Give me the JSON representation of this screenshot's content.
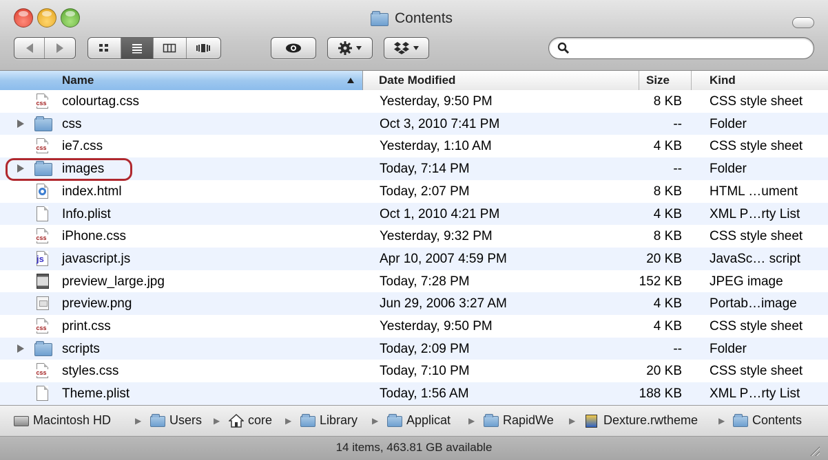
{
  "window": {
    "title": "Contents",
    "view_modes": [
      "icon-view",
      "list-view",
      "column-view",
      "coverflow-view"
    ],
    "active_view": "list-view"
  },
  "toolbar": {
    "search_placeholder": ""
  },
  "columns": {
    "name": "Name",
    "date": "Date Modified",
    "size": "Size",
    "kind": "Kind"
  },
  "rows": [
    {
      "name": "colourtag.css",
      "date": "Yesterday, 9:50 PM",
      "size": "8 KB",
      "kind": "CSS style sheet",
      "icon": "css-file-icon"
    },
    {
      "name": "css",
      "date": "Oct 3, 2010 7:41 PM",
      "size": "--",
      "kind": "Folder",
      "icon": "folder-icon"
    },
    {
      "name": "ie7.css",
      "date": "Yesterday, 1:10 AM",
      "size": "4 KB",
      "kind": "CSS style sheet",
      "icon": "css-file-icon"
    },
    {
      "name": "images",
      "date": "Today, 7:14 PM",
      "size": "--",
      "kind": "Folder",
      "icon": "folder-icon"
    },
    {
      "name": "index.html",
      "date": "Today, 2:07 PM",
      "size": "8 KB",
      "kind": "HTML …ument",
      "icon": "html-file-icon"
    },
    {
      "name": "Info.plist",
      "date": "Oct 1, 2010 4:21 PM",
      "size": "4 KB",
      "kind": "XML P…rty List",
      "icon": "plist-file-icon"
    },
    {
      "name": "iPhone.css",
      "date": "Yesterday, 9:32 PM",
      "size": "8 KB",
      "kind": "CSS style sheet",
      "icon": "css-file-icon"
    },
    {
      "name": "javascript.js",
      "date": "Apr 10, 2007 4:59 PM",
      "size": "20 KB",
      "kind": "JavaSc… script",
      "icon": "js-file-icon"
    },
    {
      "name": "preview_large.jpg",
      "date": "Today, 7:28 PM",
      "size": "152 KB",
      "kind": "JPEG image",
      "icon": "jpeg-file-icon"
    },
    {
      "name": "preview.png",
      "date": "Jun 29, 2006 3:27 AM",
      "size": "4 KB",
      "kind": "Portab…image",
      "icon": "png-file-icon"
    },
    {
      "name": "print.css",
      "date": "Yesterday, 9:50 PM",
      "size": "4 KB",
      "kind": "CSS style sheet",
      "icon": "css-file-icon"
    },
    {
      "name": "scripts",
      "date": "Today, 2:09 PM",
      "size": "--",
      "kind": "Folder",
      "icon": "folder-icon"
    },
    {
      "name": "styles.css",
      "date": "Today, 7:10 PM",
      "size": "20 KB",
      "kind": "CSS style sheet",
      "icon": "css-file-icon"
    },
    {
      "name": "Theme.plist",
      "date": "Today, 1:56 AM",
      "size": "188 KB",
      "kind": "XML P…rty List",
      "icon": "plist-file-icon"
    }
  ],
  "pathbar": [
    {
      "label": "Macintosh HD",
      "icon": "hard-drive-icon"
    },
    {
      "label": "Users",
      "icon": "folder-icon"
    },
    {
      "label": "core",
      "icon": "home-icon"
    },
    {
      "label": "Library",
      "icon": "folder-icon"
    },
    {
      "label": "Applicat",
      "icon": "folder-icon"
    },
    {
      "label": "RapidWe",
      "icon": "folder-icon"
    },
    {
      "label": "Dexture.rwtheme",
      "icon": "theme-file-icon"
    },
    {
      "label": "Contents",
      "icon": "folder-icon"
    }
  ],
  "status": "14 items, 463.81 GB available",
  "colors": {
    "selected_header": "#9fc8ef",
    "alt_row": "#edf3fe",
    "highlight_ring": "#b0282e"
  }
}
